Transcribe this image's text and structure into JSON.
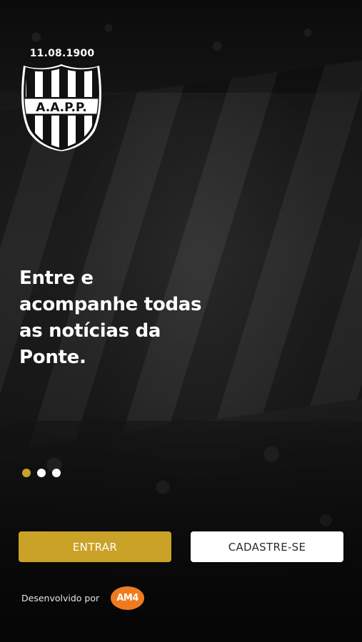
{
  "club": {
    "founding_date": "11.08.1900",
    "crest_text": "A.A.P.P.",
    "crest_icon": "shield-crest-icon"
  },
  "onboarding": {
    "headline_lines": [
      "Entre e",
      "acompanhe todas",
      "as notícias da",
      "Ponte."
    ],
    "pager": {
      "count": 3,
      "active_index": 0
    }
  },
  "actions": {
    "login_label": "ENTRAR",
    "signup_label": "CADASTRE-SE"
  },
  "footer": {
    "developed_by_label": "Desenvolvido por",
    "developer_logo_text": "AM4"
  },
  "colors": {
    "accent_gold": "#c9a227",
    "developer_orange": "#f07b1f",
    "text_white": "#ffffff"
  }
}
